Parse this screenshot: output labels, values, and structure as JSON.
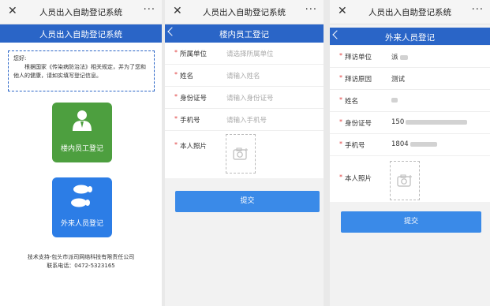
{
  "panel1": {
    "sys_title": "人员出入自助登记系统",
    "header_title": "人员出入自助登记系统",
    "notice_greeting": "您好:",
    "notice_body": "根据国家《传染病防治法》相关规定，并为了您和他人的健康，请如实填写登记信息。",
    "tile_internal_label": "楼内员工登记",
    "tile_visitor_label": "外来人员登记",
    "footer_support": "技术支持-包头市派司网络科技有限责任公司",
    "footer_phone": "联系电话：0472-5323165",
    "colors": {
      "nav": "#2a65c7",
      "tile_internal": "#4d9f3f",
      "tile_visitor": "#2c7de6"
    }
  },
  "panel2": {
    "sys_title": "人员出入自助登记系统",
    "header_title": "楼内员工登记",
    "fields": [
      {
        "label": "所属单位",
        "placeholder": "请选择所属单位"
      },
      {
        "label": "姓名",
        "placeholder": "请输入姓名"
      },
      {
        "label": "身份证号",
        "placeholder": "请输入身份证号"
      },
      {
        "label": "手机号",
        "placeholder": "请输入手机号"
      }
    ],
    "photo_label": "本人照片",
    "submit_label": "提交"
  },
  "panel3": {
    "sys_title": "人员出入自助登记系统",
    "header_title": "外来人员登记",
    "fields": [
      {
        "label": "拜访单位",
        "value": "派"
      },
      {
        "label": "拜访原因",
        "value": "测试"
      },
      {
        "label": "姓名",
        "value": ""
      },
      {
        "label": "身份证号",
        "value": "150"
      },
      {
        "label": "手机号",
        "value": "1804"
      }
    ],
    "photo_label": "本人照片",
    "submit_label": "提交"
  },
  "icons": [
    "close-icon",
    "more-icon",
    "back-icon",
    "person-icon",
    "footprints-icon",
    "camera-add-icon"
  ]
}
